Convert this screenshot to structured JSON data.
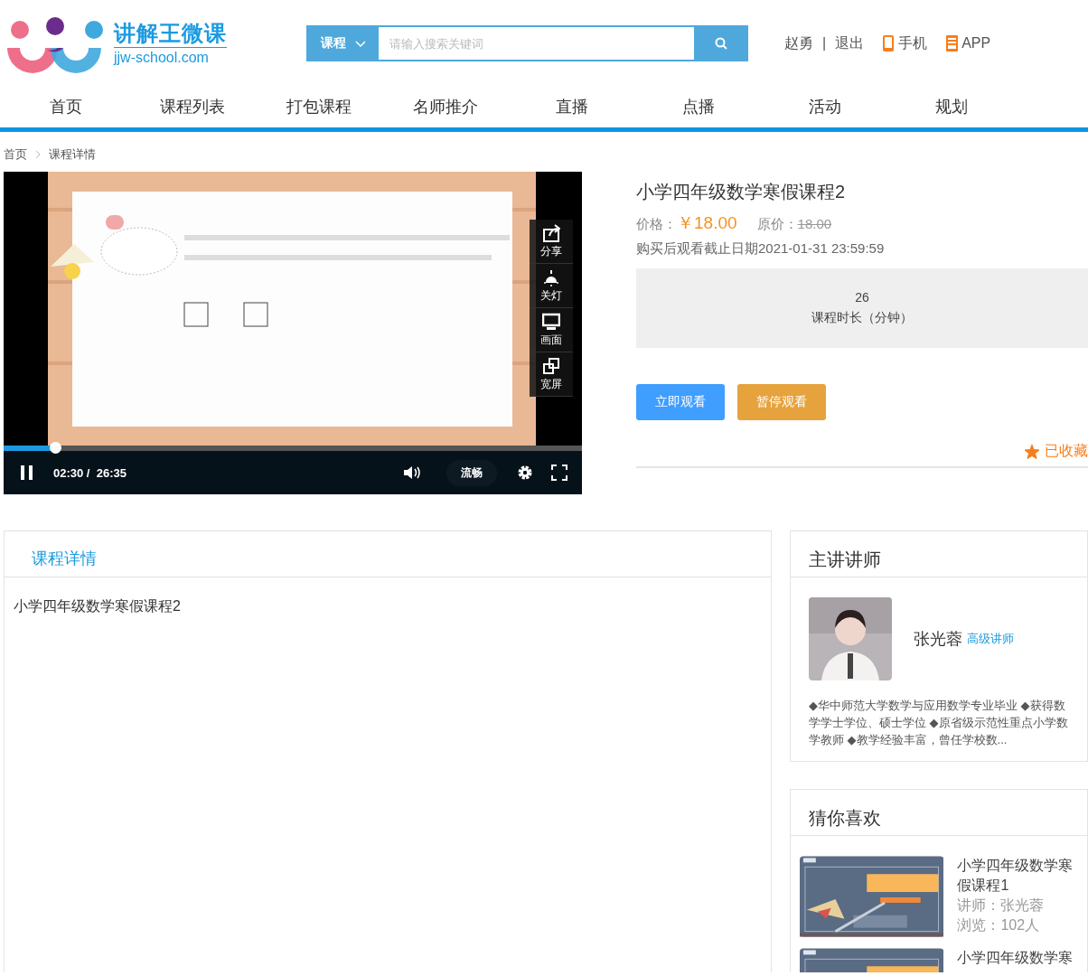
{
  "logo": {
    "name": "讲解王微课",
    "url": "jjw-school.com"
  },
  "search": {
    "category": "课程",
    "placeholder": "请输入搜索关键词"
  },
  "user": {
    "name": "赵勇",
    "separator": "|",
    "logout": "退出"
  },
  "apps": [
    {
      "kind": "phone",
      "label": "手机"
    },
    {
      "kind": "app",
      "label": "APP"
    }
  ],
  "nav": [
    "首页",
    "课程列表",
    "打包课程",
    "名师推介",
    "直播",
    "点播",
    "活动",
    "规划"
  ],
  "breadcrumb": [
    "首页",
    "课程详情"
  ],
  "player": {
    "playing": true,
    "time": "02:30 /  26:35",
    "quality": "流畅",
    "progress": {
      "level": 0.09
    },
    "side_tools": [
      {
        "kind": "share",
        "label": "分享"
      },
      {
        "kind": "light",
        "label": "关灯"
      },
      {
        "kind": "screen",
        "label": "画面"
      },
      {
        "kind": "wide",
        "label": "宽屏"
      }
    ]
  },
  "course": {
    "title": "小学四年级数学寒假课程2",
    "price_label": "价格：",
    "price": "￥18.00",
    "original_label": "原价：",
    "original_price": "18.00",
    "deadline": "购买后观看截止日期2021-01-31 23:59:59",
    "duration": {
      "value": "26",
      "label": "课程时长（分钟）"
    },
    "buttons": [
      {
        "kind": "primary",
        "label": "立即观看"
      },
      {
        "kind": "warning",
        "label": "暂停观看"
      }
    ],
    "favorite": {
      "favorited": true,
      "label": "已收藏"
    }
  },
  "details": {
    "tab": "课程详情",
    "text": "小学四年级数学寒假课程2"
  },
  "teacher": {
    "heading": "主讲讲师",
    "name": "张光蓉",
    "title": "高级讲师",
    "bio": "◆华中师范大学数学与应用数学专业毕业 ◆获得数学学士学位、硕士学位 ◆原省级示范性重点小学数学教师 ◆教学经验丰富，曾任学校数..."
  },
  "recommend": {
    "heading": "猜你喜欢",
    "items": [
      {
        "title": "小学四年级数学寒假课程1",
        "teacher": "讲师：张光蓉",
        "views": "浏览：102人"
      },
      {
        "title": "小学四年级数学寒"
      }
    ]
  }
}
